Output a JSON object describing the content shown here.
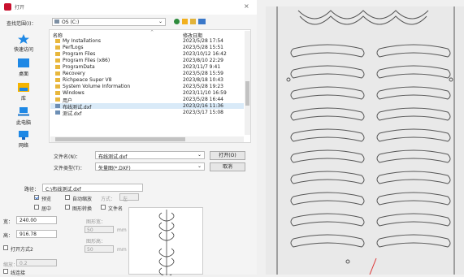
{
  "window": {
    "title": "打开",
    "close_glyph": "×"
  },
  "toolbar": {
    "lookin_label": "查找范围(I)：",
    "lookin_value": "OS (C:)"
  },
  "sidebar": {
    "items": [
      {
        "label": "快速访问",
        "icon": "star-icon",
        "color": "#1e88e5"
      },
      {
        "label": "桌面",
        "icon": "desktop-icon",
        "color": "#1e88e5"
      },
      {
        "label": "库",
        "icon": "library-icon",
        "color": "#f5b400"
      },
      {
        "label": "此电脑",
        "icon": "computer-icon",
        "color": "#1e88e5"
      },
      {
        "label": "网络",
        "icon": "network-icon",
        "color": "#1e88e5"
      }
    ]
  },
  "files": {
    "col_name": "名称",
    "col_date": "修改日期",
    "rows": [
      {
        "name": "My Installations",
        "date": "2023/5/28 17:54",
        "type": "folder"
      },
      {
        "name": "PerfLogs",
        "date": "2023/5/28 15:51",
        "type": "folder"
      },
      {
        "name": "Program Files",
        "date": "2023/10/12 16:42",
        "type": "folder"
      },
      {
        "name": "Program Files (x86)",
        "date": "2023/8/10 22:29",
        "type": "folder"
      },
      {
        "name": "ProgramData",
        "date": "2023/11/7 9:41",
        "type": "folder"
      },
      {
        "name": "Recovery",
        "date": "2023/5/28 15:59",
        "type": "folder"
      },
      {
        "name": "Richpeace Super V8",
        "date": "2023/8/18 10:43",
        "type": "folder"
      },
      {
        "name": "System Volume Information",
        "date": "2023/5/28 19:23",
        "type": "folder"
      },
      {
        "name": "Windows",
        "date": "2023/11/10 16:59",
        "type": "folder"
      },
      {
        "name": "用户",
        "date": "2023/5/28 16:44",
        "type": "folder"
      },
      {
        "name": "布线测试.dxf",
        "date": "2023/2/16 11:36",
        "type": "file",
        "selected": true
      },
      {
        "name": "测试.dxf",
        "date": "2023/3/17 15:08",
        "type": "file"
      }
    ]
  },
  "form": {
    "filename_label": "文件名(N)：",
    "filename_value": "布线测试.dxf",
    "filetype_label": "文件类型(T)：",
    "filetype_value": "矢量图(*.DXF)",
    "open_label": "打开(O)",
    "cancel_label": "取消"
  },
  "options": {
    "path_label": "路径：",
    "path_value": "C:\\布线测试.dxf",
    "preview_label": "预览",
    "autoscale_label": "自动缩放",
    "ratio_label": "方式：",
    "ratio_value": "左",
    "center_label": "居中",
    "rotate_label": "图形转换",
    "file_label": "文件名",
    "width_label": "宽：",
    "width_value": "240.00",
    "height_label": "高：",
    "height_value": "916.78",
    "new_width_label": "图形宽：",
    "new_width_value": "50",
    "new_height_label": "图形高：",
    "new_height_value": "50",
    "unit_a": "mm",
    "unit_b": "mm",
    "openmode_label": "打开方式2",
    "scale_label": "缩放：",
    "scale_value": "0.2",
    "connect_label": "线连接"
  },
  "accent": "#2a6fd6"
}
